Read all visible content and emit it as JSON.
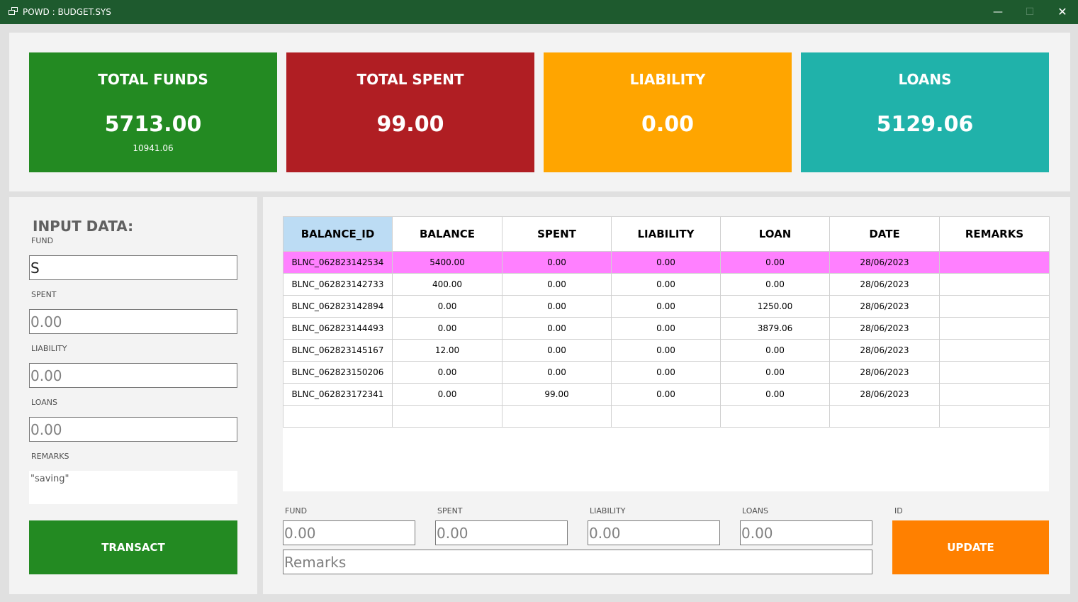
{
  "window": {
    "title": "POWD : BUDGET.SYS"
  },
  "cards": {
    "funds": {
      "title": "TOTAL FUNDS",
      "value": "5713.00",
      "sub": "10941.06",
      "color": "#238a22"
    },
    "spent": {
      "title": "TOTAL SPENT",
      "value": "99.00",
      "color": "#b01e23"
    },
    "liability": {
      "title": "LIABILITY",
      "value": "0.00",
      "color": "#ffa500"
    },
    "loans": {
      "title": "LOANS",
      "value": "5129.06",
      "color": "#20b2aa"
    }
  },
  "input": {
    "title": "INPUT DATA:",
    "fund_label": "FUND",
    "fund_value": "S",
    "spent_label": "SPENT",
    "spent_placeholder": "0.00",
    "liability_label": "LIABILITY",
    "liability_placeholder": "0.00",
    "loans_label": "LOANS",
    "loans_placeholder": "0.00",
    "remarks_label": "REMARKS",
    "remarks_value": "\"saving\"",
    "transact_label": "TRANSACT"
  },
  "table": {
    "columns": [
      "BALANCE_ID",
      "BALANCE",
      "SPENT",
      "LIABILITY",
      "LOAN",
      "DATE",
      "REMARKS"
    ],
    "rows": [
      [
        "BLNC_062823142534",
        "5400.00",
        "0.00",
        "0.00",
        "0.00",
        "28/06/2023",
        ""
      ],
      [
        "BLNC_062823142733",
        "400.00",
        "0.00",
        "0.00",
        "0.00",
        "28/06/2023",
        ""
      ],
      [
        "BLNC_062823142894",
        "0.00",
        "0.00",
        "0.00",
        "1250.00",
        "28/06/2023",
        ""
      ],
      [
        "BLNC_062823144493",
        "0.00",
        "0.00",
        "0.00",
        "3879.06",
        "28/06/2023",
        ""
      ],
      [
        "BLNC_062823145167",
        "12.00",
        "0.00",
        "0.00",
        "0.00",
        "28/06/2023",
        ""
      ],
      [
        "BLNC_062823150206",
        "0.00",
        "0.00",
        "0.00",
        "0.00",
        "28/06/2023",
        ""
      ],
      [
        "BLNC_062823172341",
        "0.00",
        "99.00",
        "0.00",
        "0.00",
        "28/06/2023",
        ""
      ],
      [
        "",
        "",
        "",
        "",
        "",
        "",
        ""
      ]
    ],
    "selected_color": "#ff80ff",
    "header_selected_color": "#bcdcf4"
  },
  "update": {
    "fund_label": "FUND",
    "fund_placeholder": "0.00",
    "spent_label": "SPENT",
    "spent_placeholder": "0.00",
    "liability_label": "LIABILITY",
    "liability_placeholder": "0.00",
    "loans_label": "LOANS",
    "loans_placeholder": "0.00",
    "id_label": "ID",
    "remarks_placeholder": "Remarks",
    "update_label": "UPDATE"
  }
}
